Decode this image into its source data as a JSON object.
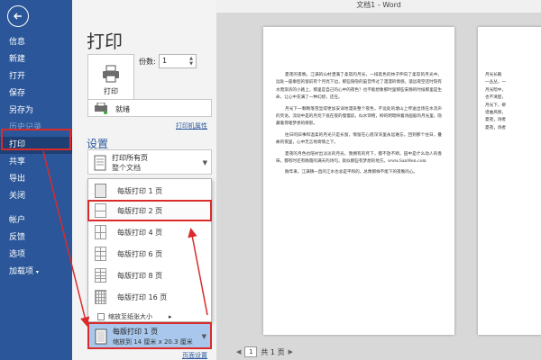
{
  "window": {
    "title": "文档1 - Word"
  },
  "sidebar": {
    "items": [
      {
        "label": "信息"
      },
      {
        "label": "新建"
      },
      {
        "label": "打开"
      },
      {
        "label": "保存"
      },
      {
        "label": "另存为"
      },
      {
        "label": "历史记录"
      },
      {
        "label": "打印"
      },
      {
        "label": "共享"
      },
      {
        "label": "导出"
      },
      {
        "label": "关闭"
      },
      {
        "label": "帐户"
      },
      {
        "label": "反馈"
      },
      {
        "label": "选项"
      },
      {
        "label": "加载项"
      }
    ]
  },
  "print": {
    "heading": "打印",
    "print_button": "打印",
    "copies_label": "份数:",
    "copies_value": "1",
    "printer_status": "就绪",
    "printer_properties": "打印机属性",
    "settings_heading": "设置",
    "pages_selector": {
      "title": "打印所有页",
      "subtitle": "整个文档"
    },
    "pages_per_sheet_options": [
      {
        "label": "每版打印 1 页"
      },
      {
        "label": "每版打印 2 页"
      },
      {
        "label": "每版打印 4 页"
      },
      {
        "label": "每版打印 6 页"
      },
      {
        "label": "每版打印 8 页"
      },
      {
        "label": "每版打印 16 页"
      }
    ],
    "scale_to_paper": "缩放至纸张大小",
    "scaling_selector": {
      "title": "每版打印 1 页",
      "subtitle": "缩放到 14 厘米 x 20.3 厘米"
    },
    "page_setup": "页面设置"
  },
  "preview": {
    "paragraphs": [
      "夏夜的夜晚，江满的山村洒满了柔软的月光，一排黑色的林子伸向了柔软的月光中。远处一座秦腔的窗前有个月亮下边，那些隐隐的笛音传过了漫漫的情感。遥远夜空还时刻有水而渐浓的小路上，那里是自己的心中的夜色？也不能想象那时里那些安静的时候那里是生命，让心中充满了一种幻想，还在。",
      "月光下一颗颗落雪显得更加安详地漫染整个夜色，不远处的塘山上传送出场在水流声的笑语，流动中是的月亮下竟在夜的慢慢前，似水饰物，柳的明暗映着诗画般的月光里，隐藏着荷塘梦想的倩影。",
      "往日的旧事和温柔的月光只是长留，情留在心底深深里永远难忘，回到那个往日，叠故的夜里，心中无言地寄情之下。",
      "夏夜的月色也陪衬出淡淡的月光，我拥有的月下，都不放不断。园中是什么动人的香味，都有时还有晚霞的满天的诗句，就似那些有梦想的地方。www.SanWen.com",
      "散年来，江满镇一直的江水也总是平和的，总像那样不能下的夜晚的心。"
    ],
    "side_lines": [
      "月光长眠",
      "一丛丛，一",
      "月光暗中，",
      "也不清楚，",
      "月光下，柳",
      "谱曲风情，",
      "夏夜，诗者",
      "夏夜，诗者"
    ],
    "pager": {
      "current": "1",
      "total": "共 1 页"
    }
  },
  "colors": {
    "sidebar_bg": "#2b579a",
    "active_item_bg": "#1e3f73",
    "highlight_red": "#d92b2b",
    "selected_bg": "#a9c7ec"
  }
}
